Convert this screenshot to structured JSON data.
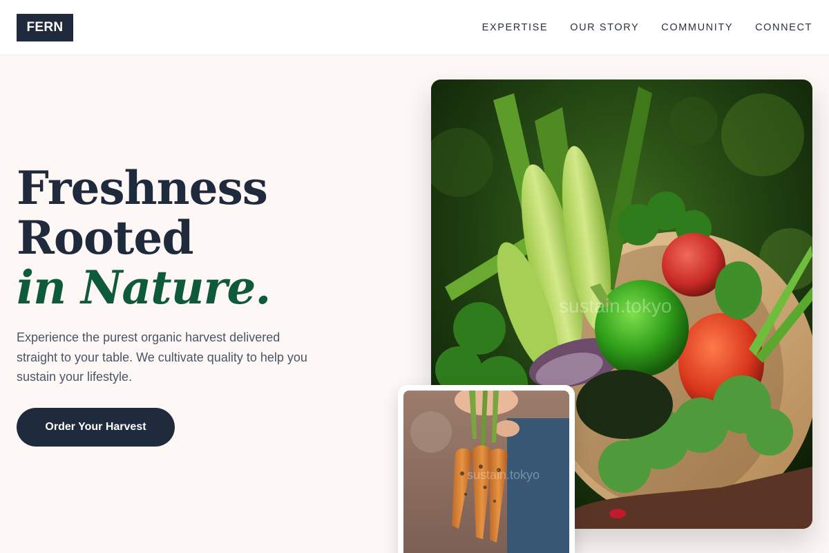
{
  "brand": {
    "logo_text": "FERN"
  },
  "nav": {
    "items": [
      {
        "label": "EXPERTISE"
      },
      {
        "label": "OUR STORY"
      },
      {
        "label": "COMMUNITY"
      },
      {
        "label": "CONNECT"
      }
    ]
  },
  "hero": {
    "title_line1": "Freshness",
    "title_line2": "Rooted",
    "title_accent": "in Nature.",
    "description": "Experience the purest organic harvest delivered straight to your table. We cultivate quality to help you sustain your lifestyle.",
    "cta_label": "Order Your Harvest"
  },
  "images": {
    "main_watermark": "sustain.tokyo",
    "small_watermark": "sustain.tokyo"
  },
  "colors": {
    "primary_dark": "#1f2a3d",
    "accent_green": "#0f5a3a",
    "background": "#fdf8f6"
  }
}
